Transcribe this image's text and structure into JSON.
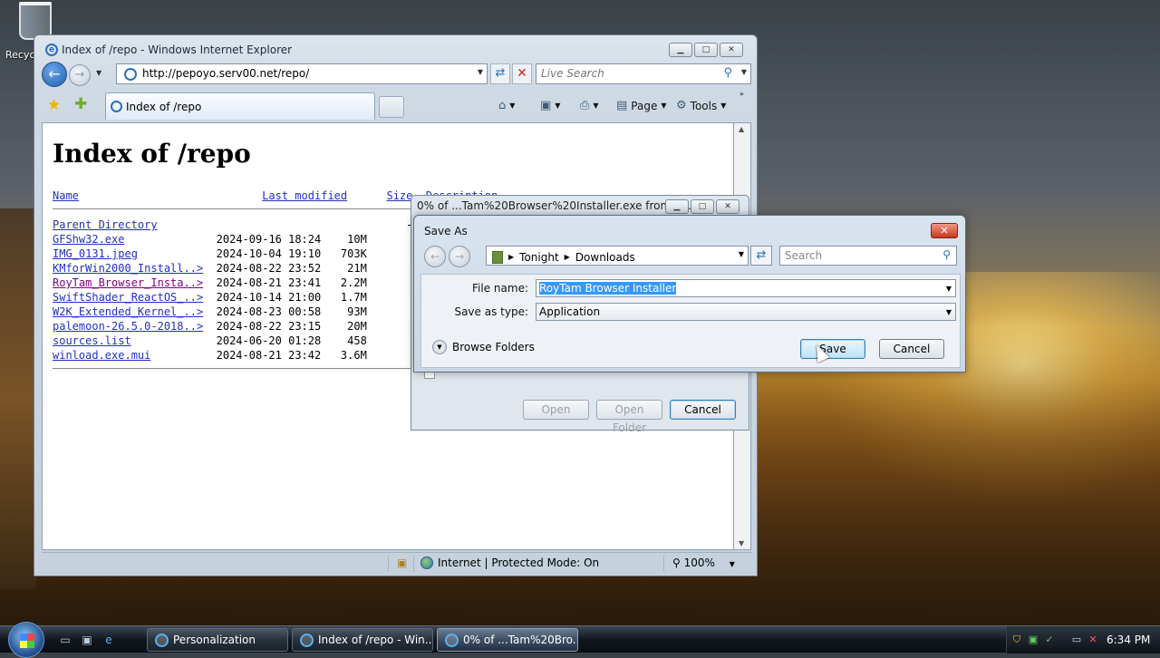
{
  "desktop": {
    "recycle_label": "Recyc"
  },
  "ie": {
    "title": "Index of /repo - Windows Internet Explorer",
    "url": "http://pepoyo.serv00.net/repo/",
    "search_placeholder": "Live Search",
    "tab_label": "Index of /repo",
    "cmd_page": "Page",
    "cmd_tools": "Tools",
    "status_zone": "Internet | Protected Mode: On",
    "zoom": "100%"
  },
  "page": {
    "heading": "Index of /repo",
    "columns": {
      "name": "Name",
      "modified": "Last modified",
      "size": "Size",
      "description": "Description"
    },
    "parent": {
      "name": "Parent Directory",
      "modified": "",
      "size": "-"
    },
    "files": [
      {
        "name": "GFShw32.exe",
        "modified": "2024-09-16 18:24",
        "size": "10M",
        "visited": false
      },
      {
        "name": "IMG_0131.jpeg",
        "modified": "2024-10-04 19:10",
        "size": "703K",
        "visited": false
      },
      {
        "name": "KMforWin2000_Install..>",
        "modified": "2024-08-22 23:52",
        "size": "21M",
        "visited": false
      },
      {
        "name": "RoyTam_Browser_Insta..>",
        "modified": "2024-08-21 23:41",
        "size": "2.2M",
        "visited": true
      },
      {
        "name": "SwiftShader_ReactOS_..>",
        "modified": "2024-10-14 21:00",
        "size": "1.7M",
        "visited": false
      },
      {
        "name": "W2K_Extended_Kernel_..>",
        "modified": "2024-08-23 00:58",
        "size": "93M",
        "visited": false
      },
      {
        "name": "palemoon-26.5.0-2018..>",
        "modified": "2024-08-22 23:15",
        "size": "20M",
        "visited": false
      },
      {
        "name": "sources.list",
        "modified": "2024-06-20 01:28",
        "size": "458",
        "visited": false
      },
      {
        "name": "winload.exe.mui",
        "modified": "2024-08-21 23:42",
        "size": "3.6M",
        "visited": false
      }
    ]
  },
  "download": {
    "title": "0% of ...Tam%20Browser%20Installer.exe from pe...",
    "open": "Open",
    "open_folder": "Open Folder",
    "cancel": "Cancel"
  },
  "saveas": {
    "title": "Save As",
    "path": [
      "Tonight",
      "Downloads"
    ],
    "search_placeholder": "Search",
    "filename_label": "File name:",
    "filename": "RoyTam Browser Installer",
    "type_label": "Save as type:",
    "type": "Application",
    "browse": "Browse Folders",
    "save": "Save",
    "cancel": "Cancel"
  },
  "taskbar": {
    "items": [
      "Personalization",
      "Index of /repo - Win...",
      "0% of ...Tam%20Bro..."
    ],
    "clock": "6:34 PM"
  }
}
